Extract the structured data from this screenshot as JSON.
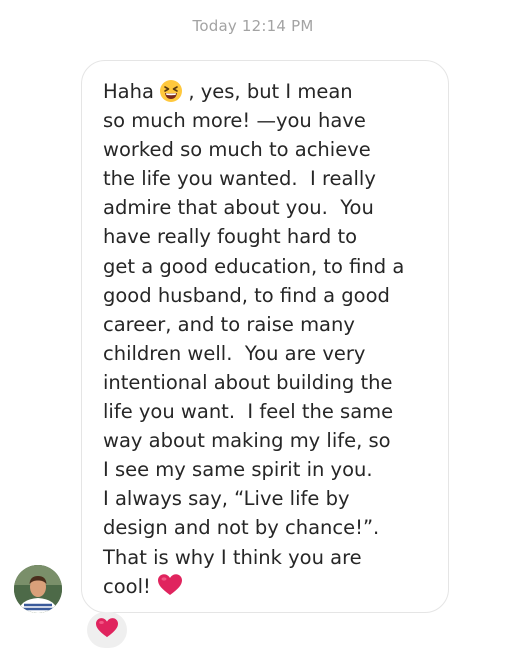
{
  "conversation": {
    "timestamp": "Today 12:14 PM"
  },
  "message": {
    "lines": [
      "Haha ",
      " , yes, but I mean",
      "so much more! —you have",
      "worked so much to achieve",
      "the life you wanted.  I really",
      "admire that about you.  You",
      "have really fought hard to",
      "get a good education, to find a",
      "good husband, to find a good",
      "career, and to raise many",
      "children well.  You are very",
      "intentional about building the",
      "life you want.  I feel the same",
      "way about making my life, so",
      "I see my same spirit in you.",
      "I always say, “Live life by",
      "design and not by chance!”.",
      "That is why I think you are",
      "cool! "
    ],
    "emoji_1": "grinning-squinting-face-icon",
    "emoji_2": "red-heart-icon"
  },
  "sender": {
    "avatar": "profile-photo"
  },
  "reaction": {
    "icon": "red-heart-icon",
    "color": "#e0245e"
  },
  "colors": {
    "bubble_border": "#e5e5e5",
    "text": "#262626",
    "timestamp": "#a3a3a3",
    "heart": "#e0245e",
    "reaction_bg": "#efefef"
  }
}
